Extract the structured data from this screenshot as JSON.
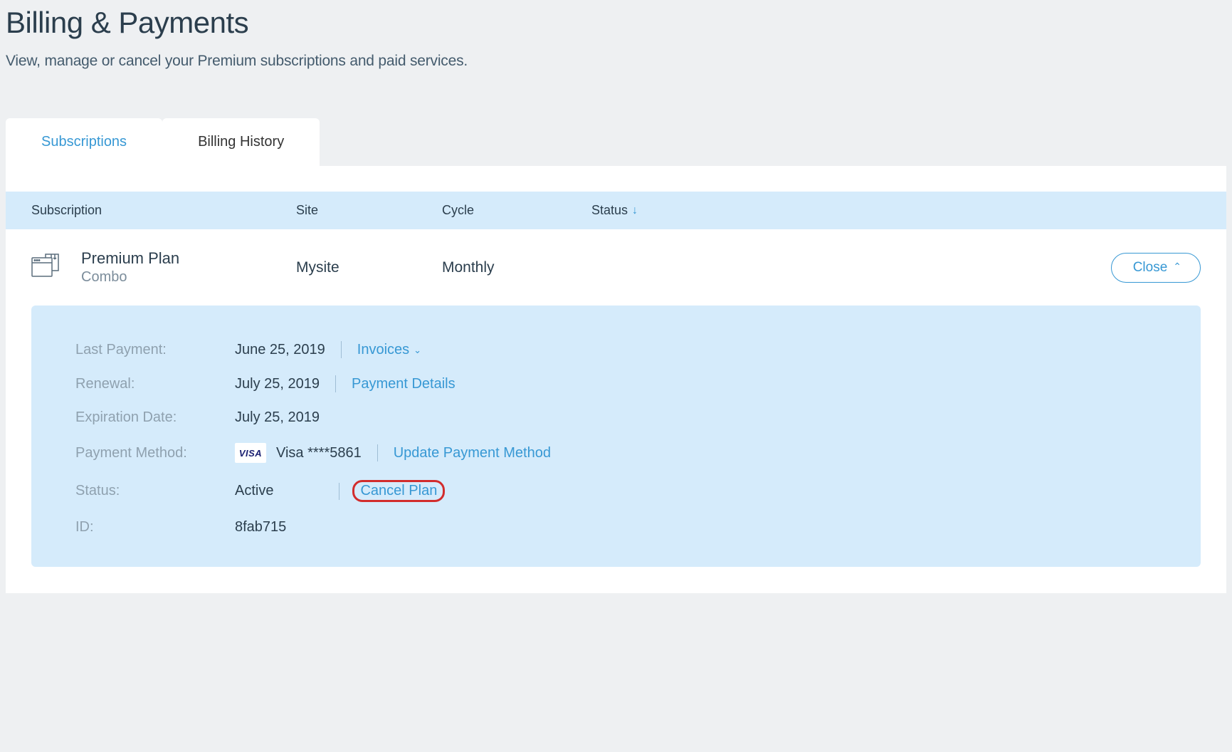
{
  "header": {
    "title": "Billing & Payments",
    "subtitle": "View, manage or cancel your Premium subscriptions and paid services."
  },
  "tabs": {
    "subscriptions": "Subscriptions",
    "billing_history": "Billing History"
  },
  "table": {
    "cols": {
      "subscription": "Subscription",
      "site": "Site",
      "cycle": "Cycle",
      "status": "Status"
    }
  },
  "row": {
    "plan_name": "Premium Plan",
    "plan_sub": "Combo",
    "site": "Mysite",
    "cycle": "Monthly",
    "close_label": "Close"
  },
  "details": {
    "last_payment_label": "Last Payment:",
    "last_payment_value": "June 25, 2019",
    "invoices_link": "Invoices",
    "renewal_label": "Renewal:",
    "renewal_value": "July 25, 2019",
    "payment_details_link": "Payment Details",
    "expiration_label": "Expiration Date:",
    "expiration_value": "July 25, 2019",
    "payment_method_label": "Payment Method:",
    "visa_badge": "VISA",
    "payment_method_value": "Visa ****5861",
    "update_payment_link": "Update Payment Method",
    "status_label": "Status:",
    "status_value": "Active",
    "cancel_plan_link": "Cancel Plan",
    "id_label": "ID:",
    "id_value": "8fab715"
  }
}
